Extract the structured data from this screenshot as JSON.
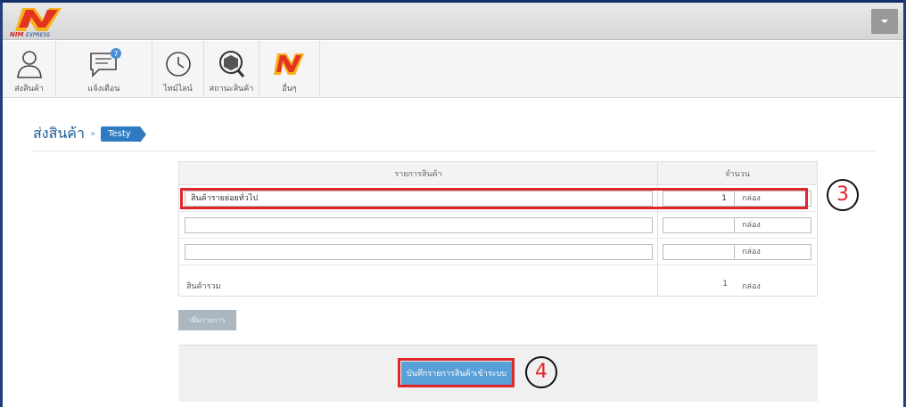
{
  "brand": {
    "logo_text": "NIM EXPRESS"
  },
  "nav": [
    {
      "label": "ส่งสินค้า",
      "icon": "user-icon"
    },
    {
      "label": "แจ้งเตือน",
      "icon": "chat-bubble-icon",
      "badge": "7"
    },
    {
      "label": "ไทม์ไลน์",
      "icon": "clock-icon"
    },
    {
      "label": "สถานะสินค้า",
      "icon": "box-search-icon"
    },
    {
      "label": "อื่นๆ",
      "icon": "nim-logo-icon"
    }
  ],
  "breadcrumb": {
    "title": "ส่งสินค้า",
    "separator": "»",
    "current": "Testy"
  },
  "table": {
    "col_item": "รายการสินค้า",
    "col_qty": "จำนวน",
    "rows": [
      {
        "item": "สินค้ารายย่อยทั่วไป",
        "qty": "1",
        "unit": "กล่อง"
      },
      {
        "item": "",
        "qty": "",
        "unit": "กล่อง"
      },
      {
        "item": "",
        "qty": "",
        "unit": "กล่อง"
      }
    ],
    "total_label": "สินค้ารวม",
    "total_qty": "1",
    "total_unit": "กล่อง"
  },
  "add_button": "เพิ่มรายการ",
  "save_button": "บันทึกรายการสินค้าเข้าระบบ",
  "annotations": {
    "step3": "3",
    "step4": "4"
  },
  "colors": {
    "accent": "#2e7bc4",
    "highlight": "#e0262b",
    "frame": "#1f3f7d"
  }
}
